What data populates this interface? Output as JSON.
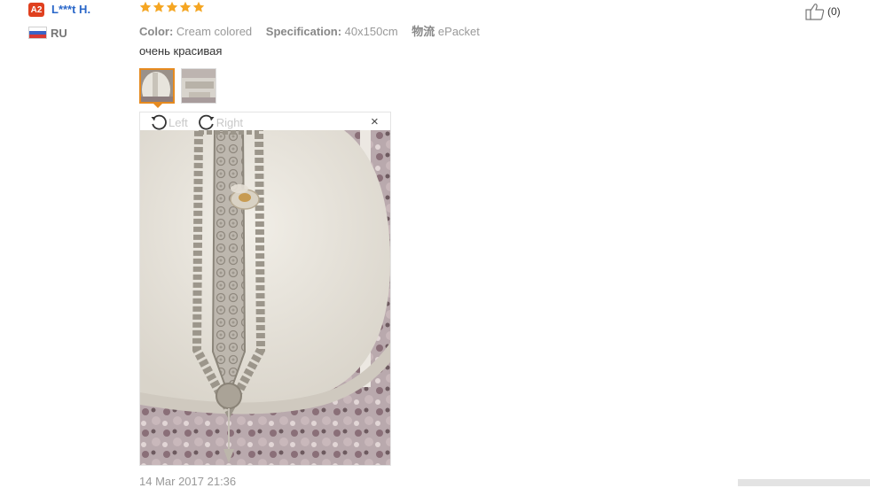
{
  "reviewer": {
    "level": "A2",
    "name": "L***t H.",
    "country": "RU"
  },
  "rating": {
    "stars": 5,
    "max": 5,
    "color": "#f5a623"
  },
  "helpful": {
    "icon": "thumbs-up-icon",
    "count": "(0)"
  },
  "specs": {
    "color_key": "Color:",
    "color_value": "Cream colored",
    "spec_key": "Specification:",
    "spec_value": "40x150cm",
    "shipping_key": "物流",
    "shipping_value": "ePacket"
  },
  "feedback": "очень красивая",
  "viewer": {
    "rotate_left": "Left",
    "rotate_right": "Right",
    "close": "×"
  },
  "date": "14 Mar 2017 21:36",
  "colors": {
    "accent": "#e68a1f",
    "link": "#2a67c9",
    "badge": "#e0401f"
  }
}
